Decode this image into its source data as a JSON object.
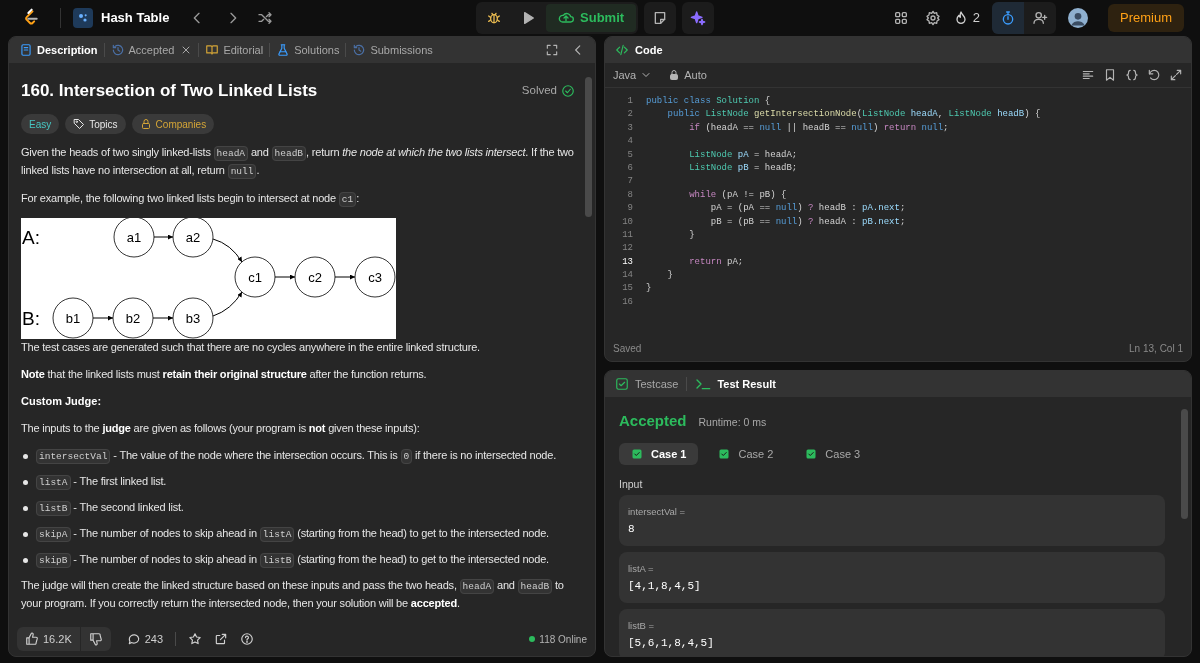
{
  "top_bar": {
    "problem_list": "Hash Table",
    "submit": "Submit",
    "streak": "2",
    "premium": "Premium"
  },
  "left_tabs": [
    {
      "label": "Description",
      "kind": "description",
      "selected": true,
      "closable": false
    },
    {
      "label": "Accepted",
      "kind": "accepted",
      "selected": false,
      "closable": true
    },
    {
      "label": "Editorial",
      "kind": "editorial",
      "selected": false,
      "closable": false
    },
    {
      "label": "Solutions",
      "kind": "solutions",
      "selected": false,
      "closable": false
    },
    {
      "label": "Submissions",
      "kind": "submissions",
      "selected": false,
      "closable": false
    }
  ],
  "problem": {
    "title": "160. Intersection of Two Linked Lists",
    "status": "Solved",
    "tags": [
      {
        "label": "Easy",
        "kind": "difficulty"
      },
      {
        "label": "Topics",
        "kind": "topics"
      },
      {
        "label": "Companies",
        "kind": "companies"
      }
    ]
  },
  "description": [
    {
      "kind": "paragraph",
      "segments": [
        {
          "text": "Given the heads of two singly linked-lists "
        },
        {
          "code": "headA"
        },
        {
          "text": " and "
        },
        {
          "code": "headB"
        },
        {
          "text": ", return *the node at which the two lists intersect*. If the two linked lists have no intersection at all, return "
        },
        {
          "code": "null"
        },
        {
          "text": "."
        }
      ]
    },
    {
      "kind": "paragraph",
      "segments": [
        {
          "text": "For example, the following two linked lists begin to intersect at node "
        },
        {
          "code": "c1"
        },
        {
          "text": ":"
        }
      ]
    },
    {
      "kind": "figure",
      "row_labels": [
        "A:",
        "B:"
      ],
      "list_a": [
        "a1",
        "a2"
      ],
      "list_b": [
        "b1",
        "b2",
        "b3"
      ],
      "shared": [
        "c1",
        "c2",
        "c3"
      ]
    },
    {
      "kind": "paragraph",
      "segments": [
        {
          "text": "The test cases are generated such that there are no cycles anywhere in the entire linked structure."
        }
      ]
    },
    {
      "kind": "paragraph",
      "segments": [
        {
          "text": "**Note** that the linked lists must **retain their original structure** after the function returns."
        }
      ]
    },
    {
      "kind": "heading",
      "text": "Custom Judge:"
    },
    {
      "kind": "paragraph",
      "segments": [
        {
          "text": "The inputs to the **judge** are given as follows (your program is **not** given these inputs):"
        }
      ]
    },
    {
      "kind": "bullet",
      "segments": [
        {
          "code": "intersectVal"
        },
        {
          "text": " - The value of the node where the intersection occurs. This is "
        },
        {
          "code": "0"
        },
        {
          "text": " if there is no intersected node."
        }
      ]
    },
    {
      "kind": "bullet",
      "segments": [
        {
          "code": "listA"
        },
        {
          "text": " - The first linked list."
        }
      ]
    },
    {
      "kind": "bullet",
      "segments": [
        {
          "code": "listB"
        },
        {
          "text": " - The second linked list."
        }
      ]
    },
    {
      "kind": "bullet",
      "segments": [
        {
          "code": "skipA"
        },
        {
          "text": " - The number of nodes to skip ahead in "
        },
        {
          "code": "listA"
        },
        {
          "text": " (starting from the head) to get to the intersected node."
        }
      ]
    },
    {
      "kind": "bullet",
      "segments": [
        {
          "code": "skipB"
        },
        {
          "text": " - The number of nodes to skip ahead in "
        },
        {
          "code": "listB"
        },
        {
          "text": " (starting from the head) to get to the intersected node."
        }
      ]
    },
    {
      "kind": "paragraph",
      "segments": [
        {
          "text": "The judge will then create the linked structure based on these inputs and pass the two heads, "
        },
        {
          "code": "headA"
        },
        {
          "text": " and "
        },
        {
          "code": "headB"
        },
        {
          "text": " to your program. If you correctly return the intersected node, then your solution will be **accepted**."
        }
      ]
    }
  ],
  "footer": {
    "likes": "16.2K",
    "comments": "243",
    "online": "118 Online"
  },
  "editor": {
    "title": "Code",
    "language": "Java",
    "mode": "Auto",
    "status": "Saved",
    "cursor": "Ln 13, Col 1",
    "lines": [
      {
        "number": "1",
        "active": false,
        "tokens": [
          {
            "text": "public class ",
            "kind": "keyword"
          },
          {
            "text": "Solution",
            "kind": "type"
          },
          {
            "text": " {",
            "kind": "plain"
          }
        ]
      },
      {
        "number": "2",
        "active": false,
        "tokens": [
          {
            "text": "    public ",
            "kind": "keyword"
          },
          {
            "text": "ListNode",
            "kind": "type"
          },
          {
            "text": " getIntersectionNode",
            "kind": "function"
          },
          {
            "text": "(",
            "kind": "plain"
          },
          {
            "text": "ListNode",
            "kind": "type"
          },
          {
            "text": " headA",
            "kind": "variable"
          },
          {
            "text": ", ",
            "kind": "plain"
          },
          {
            "text": "ListNode",
            "kind": "type"
          },
          {
            "text": " headB",
            "kind": "variable"
          },
          {
            "text": ") {",
            "kind": "plain"
          }
        ]
      },
      {
        "number": "3",
        "active": false,
        "tokens": [
          {
            "text": "        if",
            "kind": "control"
          },
          {
            "text": " (headA == ",
            "kind": "plain"
          },
          {
            "text": "null",
            "kind": "keyword"
          },
          {
            "text": " || headB == ",
            "kind": "plain"
          },
          {
            "text": "null",
            "kind": "keyword"
          },
          {
            "text": ") ",
            "kind": "plain"
          },
          {
            "text": "return",
            "kind": "control"
          },
          {
            "text": " null",
            "kind": "keyword"
          },
          {
            "text": ";",
            "kind": "plain"
          }
        ]
      },
      {
        "number": "4",
        "active": false
      },
      {
        "number": "5",
        "active": false,
        "tokens": [
          {
            "text": "        ListNode",
            "kind": "type"
          },
          {
            "text": " pA",
            "kind": "variable"
          },
          {
            "text": " = headA;",
            "kind": "plain"
          }
        ]
      },
      {
        "number": "6",
        "active": false,
        "tokens": [
          {
            "text": "        ListNode",
            "kind": "type"
          },
          {
            "text": " pB",
            "kind": "variable"
          },
          {
            "text": " = headB;",
            "kind": "plain"
          }
        ]
      },
      {
        "number": "7",
        "active": false
      },
      {
        "number": "8",
        "active": false,
        "tokens": [
          {
            "text": "        while",
            "kind": "control"
          },
          {
            "text": " (pA != pB) {",
            "kind": "plain"
          }
        ]
      },
      {
        "number": "9",
        "active": false,
        "tokens": [
          {
            "text": "            pA = (pA == ",
            "kind": "plain"
          },
          {
            "text": "null",
            "kind": "keyword"
          },
          {
            "text": ") ",
            "kind": "plain"
          },
          {
            "text": "?",
            "kind": "control"
          },
          {
            "text": " headB : ",
            "kind": "plain"
          },
          {
            "text": "pA.next",
            "kind": "variable"
          },
          {
            "text": ";",
            "kind": "plain"
          }
        ]
      },
      {
        "number": "10",
        "active": false,
        "tokens": [
          {
            "text": "            pB = (pB == ",
            "kind": "plain"
          },
          {
            "text": "null",
            "kind": "keyword"
          },
          {
            "text": ") ",
            "kind": "plain"
          },
          {
            "text": "?",
            "kind": "control"
          },
          {
            "text": " headA : ",
            "kind": "plain"
          },
          {
            "text": "pB.next",
            "kind": "variable"
          },
          {
            "text": ";",
            "kind": "plain"
          }
        ]
      },
      {
        "number": "11",
        "active": false,
        "tokens": [
          {
            "text": "        }",
            "kind": "plain"
          }
        ]
      },
      {
        "number": "12",
        "active": false
      },
      {
        "number": "13",
        "active": true,
        "tokens": [
          {
            "text": "        return",
            "kind": "control"
          },
          {
            "text": " pA;",
            "kind": "plain"
          }
        ]
      },
      {
        "number": "14",
        "active": false,
        "tokens": [
          {
            "text": "    }",
            "kind": "plain"
          }
        ]
      },
      {
        "number": "15",
        "active": false,
        "tokens": [
          {
            "text": "}",
            "kind": "plain"
          }
        ]
      },
      {
        "number": "16",
        "active": false
      }
    ]
  },
  "result_tabs": [
    {
      "label": "Testcase",
      "kind": "testcase",
      "selected": false
    },
    {
      "label": "Test Result",
      "kind": "result",
      "selected": true
    }
  ],
  "result": {
    "verdict": "Accepted",
    "runtime": "Runtime: 0 ms",
    "cases": [
      {
        "label": "Case 1",
        "selected": true,
        "passed": true
      },
      {
        "label": "Case 2",
        "selected": false,
        "passed": true
      },
      {
        "label": "Case 3",
        "selected": false,
        "passed": true
      }
    ],
    "input_label": "Input",
    "inputs": [
      {
        "name": "intersectVal =",
        "value": "8"
      },
      {
        "name": "listA =",
        "value": "[4,1,8,4,5]"
      },
      {
        "name": "listB =",
        "value": "[5,6,1,8,4,5]"
      }
    ]
  }
}
